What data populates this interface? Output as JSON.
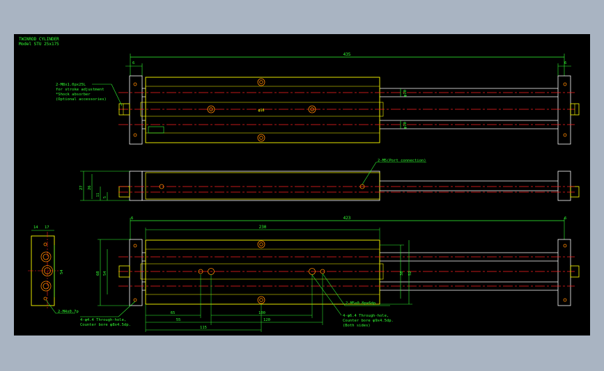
{
  "title": {
    "name": "TWINROD CYLINDER",
    "model": "Model STU 25x175"
  },
  "colors": {
    "background": "#000000",
    "frame": "#a9b4c2",
    "outline": "#ffffff",
    "part": "#ffff00",
    "centerline": "#ff2020",
    "dimension": "#33ff33",
    "hole": "#ff8800"
  },
  "top_view": {
    "dim_total": "435",
    "dim_left": "6",
    "dim_right": "6",
    "rod_dia_upper": "φ10",
    "rod_dia_lower": "φ10",
    "body_center_text": "φ16",
    "callout": [
      "2-M8x1.0px25L",
      "for stroke adjustment",
      "*Shock absorber",
      "(Optional accessories)"
    ]
  },
  "side_view": {
    "dim_height": "27",
    "dim_inner": "26",
    "dim_small_a": "11",
    "dim_small_b": "5",
    "port_callout": "2-M5(Port connection)"
  },
  "bottom_view": {
    "dim_total": "423",
    "dim_left": "6",
    "dim_right": "6",
    "dim_body": "230",
    "dim_height_outer": "68",
    "dim_height_inner": "54",
    "dim_right_a": "38",
    "dim_right_b": "52",
    "dims_bottom": [
      "65",
      "100",
      "55",
      "120",
      "115"
    ],
    "callouts": {
      "thread": "2-M5x0.8px6dp",
      "through_right": [
        "4-φ6.4 Through-hole,",
        "Counter bore φ9x4.5dp.",
        "(Both sides)"
      ],
      "through_left": [
        "4-φ4.4 Through-hole,",
        "Counter bore φ8x4.5dp."
      ]
    }
  },
  "end_view": {
    "dim_a": "14",
    "dim_b": "17",
    "dim_c": "54",
    "callout": "2-M4x0.7p"
  }
}
